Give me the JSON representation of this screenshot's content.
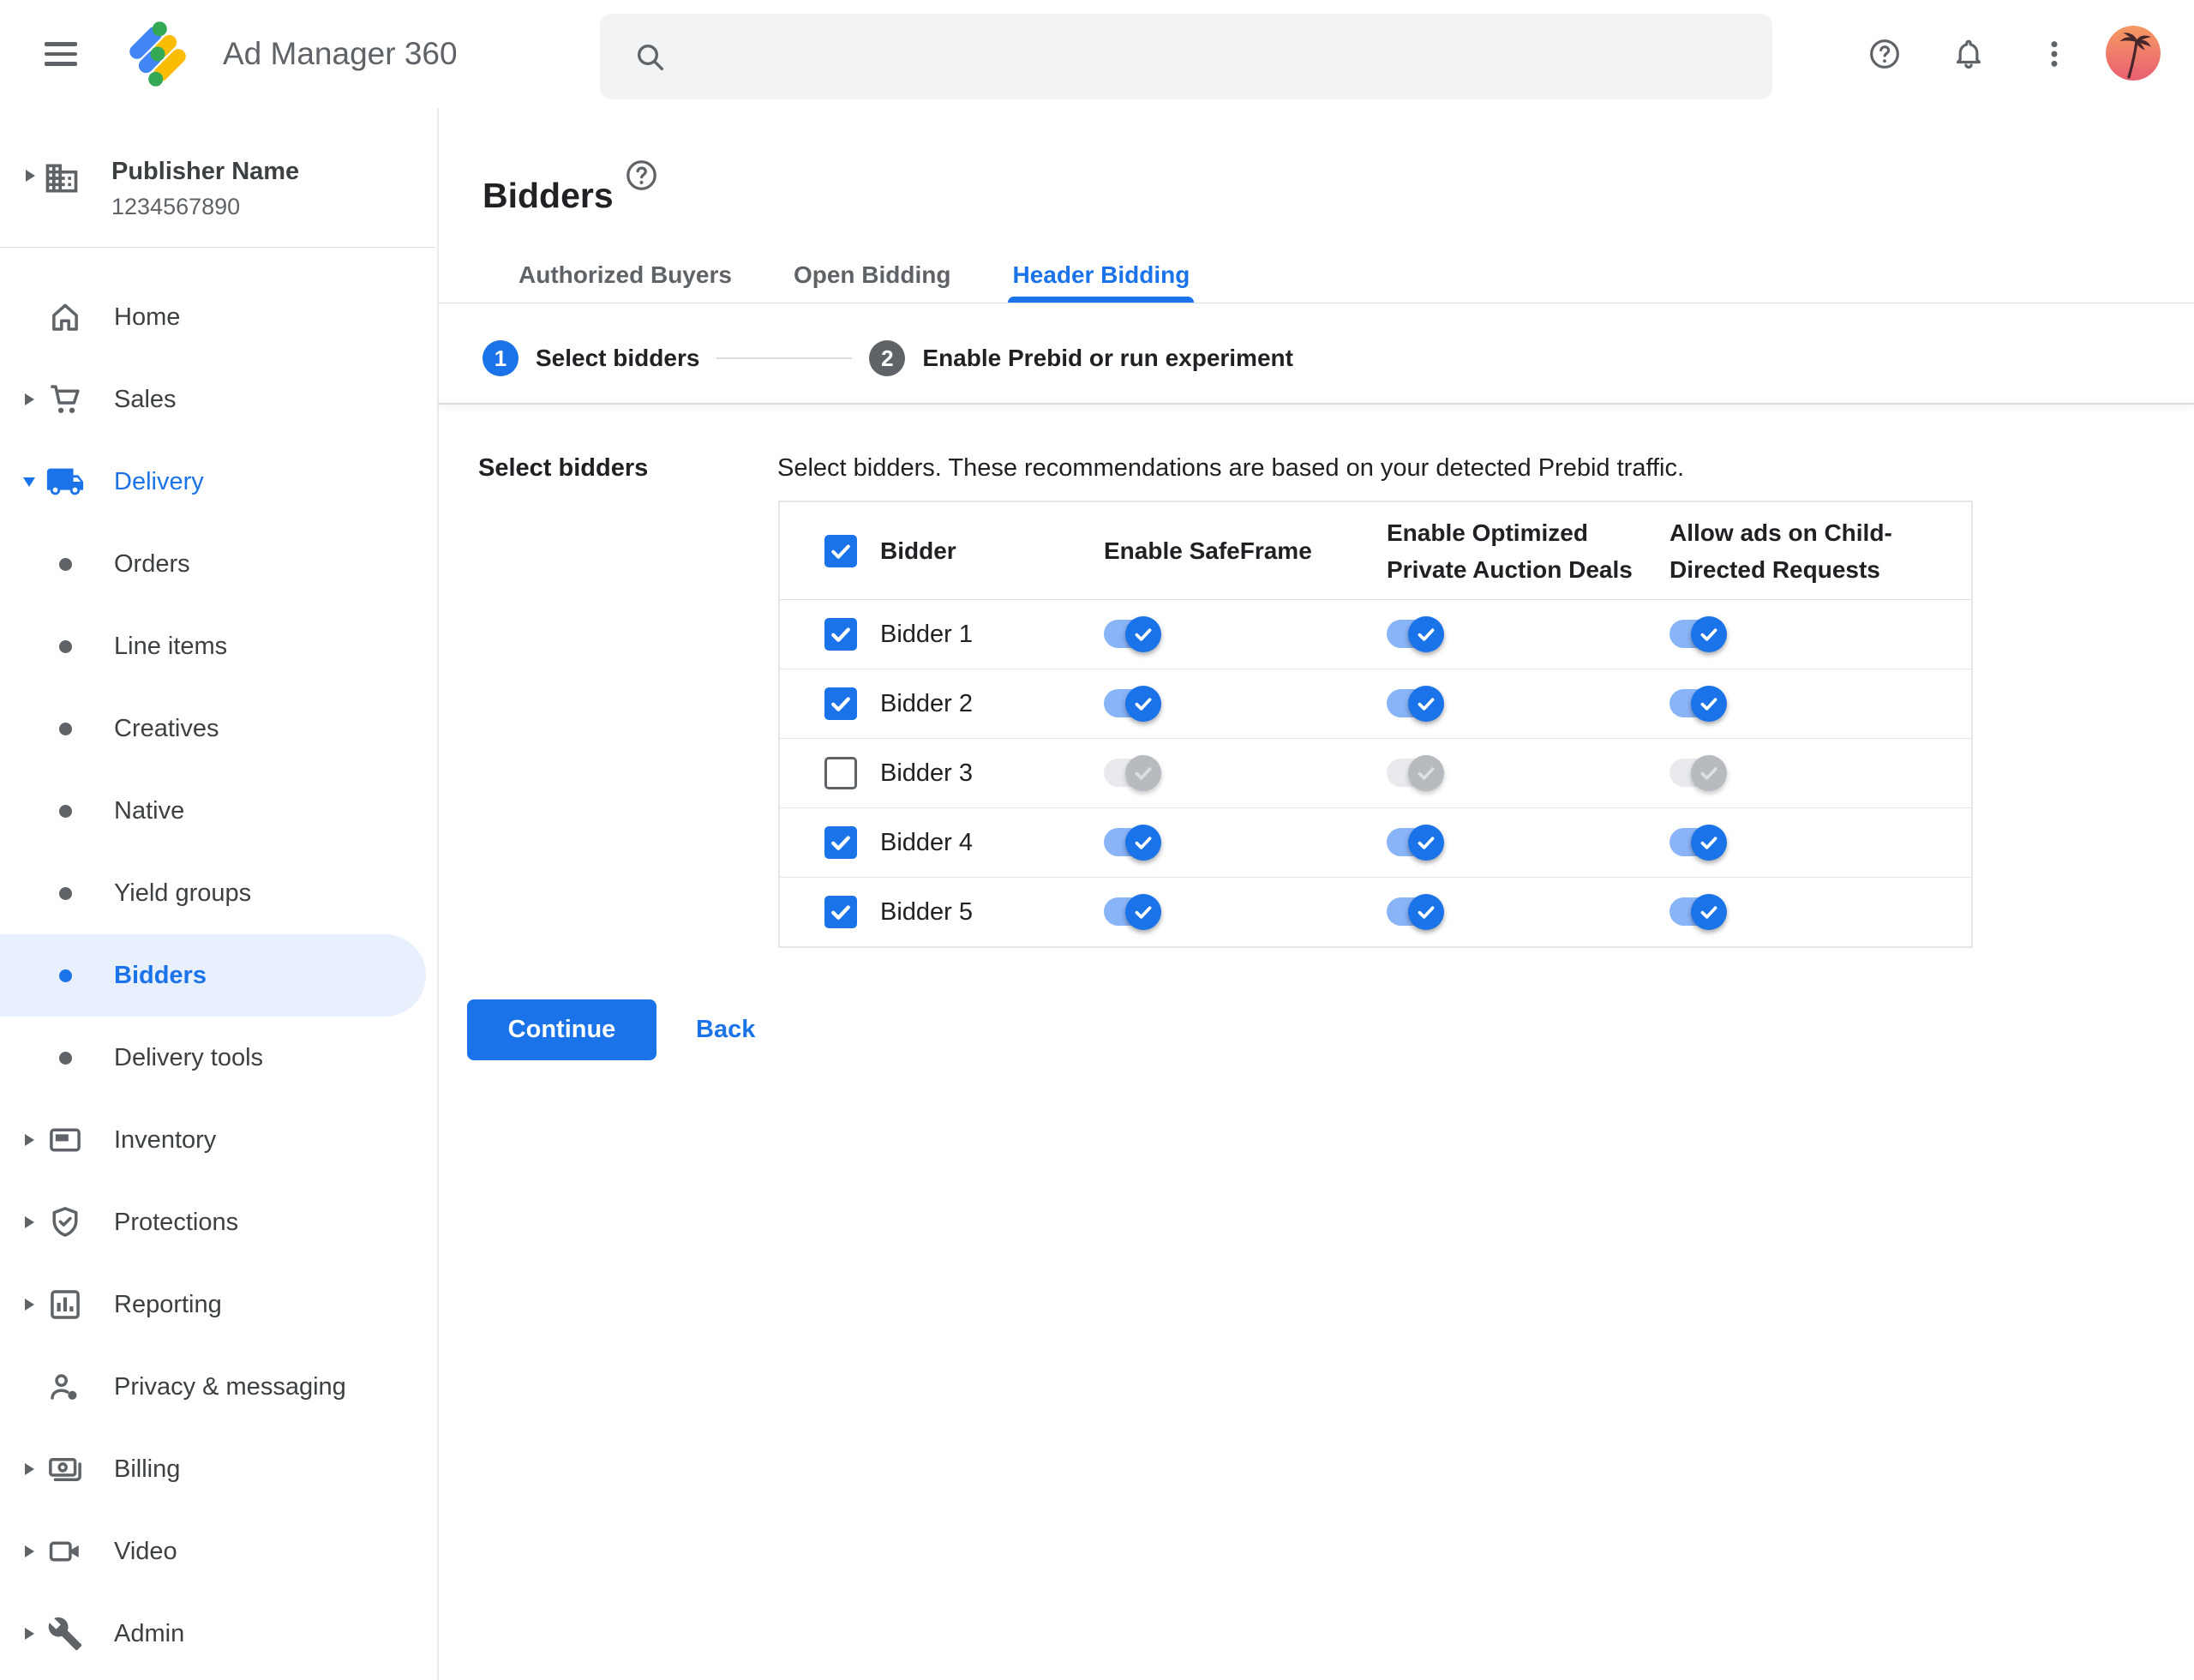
{
  "topbar": {
    "app_title": "Ad Manager 360",
    "search": {
      "value": "",
      "placeholder": ""
    },
    "icons": [
      "menu-icon",
      "ad-manager-logo",
      "search-icon",
      "help-icon",
      "notifications-bell-icon",
      "more-vert-icon",
      "avatar"
    ]
  },
  "sidebar": {
    "publisher": {
      "name": "Publisher Name",
      "id": "1234567890",
      "icon": "building-icon"
    },
    "items": [
      {
        "label": "Home",
        "icon": "home",
        "arrow": "none",
        "type": "top"
      },
      {
        "label": "Sales",
        "icon": "cart",
        "arrow": "right",
        "type": "top"
      },
      {
        "label": "Delivery",
        "icon": "truck",
        "arrow": "down",
        "type": "top",
        "active": true
      },
      {
        "label": "Orders",
        "type": "sub"
      },
      {
        "label": "Line items",
        "type": "sub"
      },
      {
        "label": "Creatives",
        "type": "sub"
      },
      {
        "label": "Native",
        "type": "sub"
      },
      {
        "label": "Yield groups",
        "type": "sub"
      },
      {
        "label": "Bidders",
        "type": "sub",
        "selected": true
      },
      {
        "label": "Delivery tools",
        "type": "sub"
      },
      {
        "label": "Inventory",
        "icon": "inventory",
        "arrow": "right",
        "type": "top"
      },
      {
        "label": "Protections",
        "icon": "shield",
        "arrow": "right",
        "type": "top"
      },
      {
        "label": "Reporting",
        "icon": "report",
        "arrow": "right",
        "type": "top"
      },
      {
        "label": "Privacy & messaging",
        "icon": "privacy",
        "arrow": "none",
        "type": "top"
      },
      {
        "label": "Billing",
        "icon": "billing",
        "arrow": "right",
        "type": "top"
      },
      {
        "label": "Video",
        "icon": "video",
        "arrow": "right",
        "type": "top"
      },
      {
        "label": "Admin",
        "icon": "admin",
        "arrow": "right",
        "type": "top"
      }
    ]
  },
  "page": {
    "title": "Bidders",
    "title_help_icon": "help-icon",
    "tabs": [
      {
        "label": "Authorized Buyers",
        "active": false
      },
      {
        "label": "Open Bidding",
        "active": false
      },
      {
        "label": "Header Bidding",
        "active": true
      }
    ],
    "stepper": [
      {
        "num": "1",
        "label": "Select bidders",
        "state": "active"
      },
      {
        "num": "2",
        "label": "Enable Prebid or run experiment",
        "state": "inactive"
      }
    ]
  },
  "content": {
    "section_label": "Select bidders",
    "description": "Select bidders. These recommendations are based on your detected Prebid traffic.",
    "table": {
      "columns": [
        "Bidder",
        "Enable SafeFrame",
        "Enable Optimized Private Auction Deals",
        "Allow ads on Child-Directed Requests"
      ],
      "header_checkbox_checked": true,
      "rows": [
        {
          "name": "Bidder 1",
          "checked": true,
          "toggles": [
            true,
            true,
            true
          ]
        },
        {
          "name": "Bidder 2",
          "checked": true,
          "toggles": [
            true,
            true,
            true
          ]
        },
        {
          "name": "Bidder 3",
          "checked": false,
          "toggles": [
            false,
            false,
            false
          ]
        },
        {
          "name": "Bidder 4",
          "checked": true,
          "toggles": [
            true,
            true,
            true
          ]
        },
        {
          "name": "Bidder 5",
          "checked": true,
          "toggles": [
            true,
            true,
            true
          ]
        }
      ]
    },
    "continue_label": "Continue",
    "back_label": "Back"
  },
  "colors": {
    "accent_blue": "#1a73e8",
    "selected_item_bg": "#e8f0fe",
    "toggle_on_track": "#8ab4f8",
    "toggle_off_track": "#e9eaee",
    "toggle_off_thumb": "#b7babe",
    "text_primary": "#202124",
    "text_secondary": "#5f6368",
    "border": "#dadce0",
    "search_bg": "#f1f3f4"
  }
}
